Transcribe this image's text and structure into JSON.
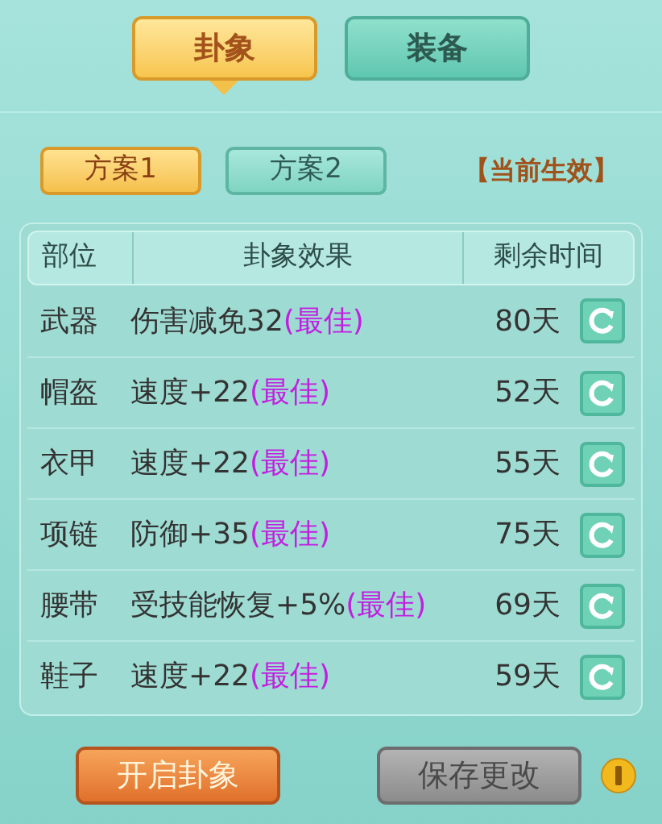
{
  "tabs": [
    {
      "label": "卦象",
      "selected": true
    },
    {
      "label": "装备",
      "selected": false
    }
  ],
  "schemes": [
    {
      "label": "方案1",
      "selected": true
    },
    {
      "label": "方案2",
      "selected": false
    }
  ],
  "status": "【当前生效】",
  "table": {
    "columns": [
      "部位",
      "卦象效果",
      "剩余时间"
    ],
    "rows": [
      {
        "slot": "武器",
        "effect": "伤害减免32",
        "tag": "(最佳)",
        "remaining": "80天"
      },
      {
        "slot": "帽盔",
        "effect": "速度+22",
        "tag": "(最佳)",
        "remaining": "52天"
      },
      {
        "slot": "衣甲",
        "effect": "速度+22",
        "tag": "(最佳)",
        "remaining": "55天"
      },
      {
        "slot": "项链",
        "effect": "防御+35",
        "tag": "(最佳)",
        "remaining": "75天"
      },
      {
        "slot": "腰带",
        "effect": "受技能恢复+5%",
        "tag": "(最佳)",
        "remaining": "69天"
      },
      {
        "slot": "鞋子",
        "effect": "速度+22",
        "tag": "(最佳)",
        "remaining": "59天"
      }
    ]
  },
  "buttons": [
    {
      "label": "开启卦象",
      "disabled": false
    },
    {
      "label": "保存更改",
      "disabled": true
    }
  ]
}
